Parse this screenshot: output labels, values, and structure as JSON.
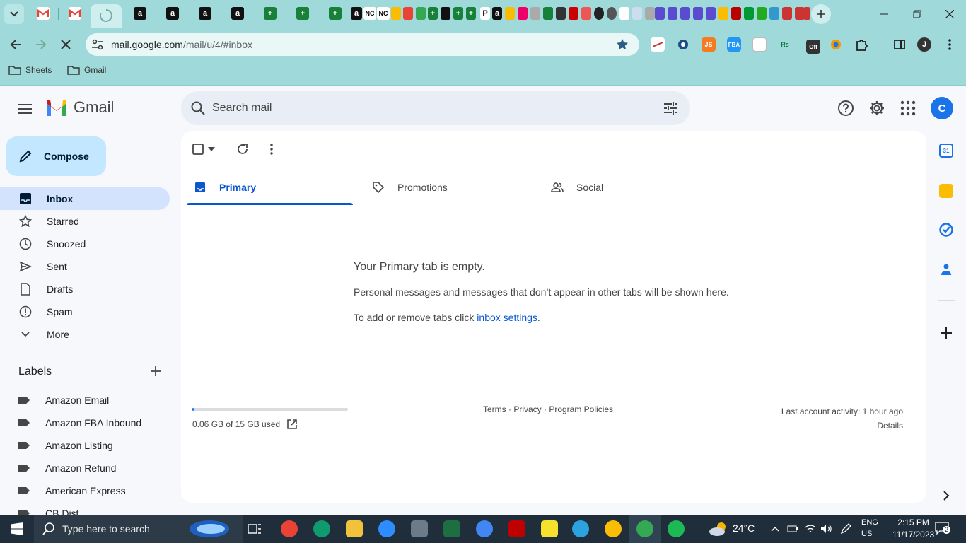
{
  "browser": {
    "url_host": "mail.google.com",
    "url_path": "/mail/u/4/#inbox",
    "tab_glyphs": [
      "a",
      "a",
      "a",
      "a",
      "NC",
      "NC",
      "a",
      "P",
      "a"
    ],
    "bookmarks": [
      "Sheets",
      "Gmail"
    ],
    "extension_labels": [
      "JS",
      "FBA",
      "Rs",
      "Off"
    ],
    "profile_initial": "J"
  },
  "gmail": {
    "logo_text": "Gmail",
    "search_placeholder": "Search mail",
    "avatar_initial": "C",
    "compose_label": "Compose",
    "nav": [
      {
        "label": "Inbox",
        "icon": "inbox-icon"
      },
      {
        "label": "Starred",
        "icon": "star-icon"
      },
      {
        "label": "Snoozed",
        "icon": "clock-icon"
      },
      {
        "label": "Sent",
        "icon": "send-icon"
      },
      {
        "label": "Drafts",
        "icon": "draft-icon"
      },
      {
        "label": "Spam",
        "icon": "spam-icon"
      },
      {
        "label": "More",
        "icon": "chevron-down-icon"
      }
    ],
    "labels_heading": "Labels",
    "labels": [
      "Amazon Email",
      "Amazon FBA Inbound",
      "Amazon Listing",
      "Amazon Refund",
      "American Express",
      "CB Dist"
    ],
    "tabs": [
      {
        "label": "Primary",
        "icon": "inbox-tab-icon"
      },
      {
        "label": "Promotions",
        "icon": "tag-icon"
      },
      {
        "label": "Social",
        "icon": "people-icon"
      }
    ],
    "empty": {
      "title": "Your Primary tab is empty.",
      "description": "Personal messages and messages that don’t appear in other tabs will be shown here.",
      "settings_prefix": "To add or remove tabs click ",
      "settings_link": "inbox settings",
      "settings_suffix": "."
    },
    "storage_text": "0.06 GB of 15 GB used",
    "storage_fraction": 0.004,
    "footer_links": "Terms · Privacy · Program Policies",
    "last_activity": "Last account activity: 1 hour ago",
    "details_link": "Details",
    "calendar_day": "31"
  },
  "taskbar": {
    "search_placeholder": "Type here to search",
    "weather": "24°C",
    "lang": "ENG",
    "region": "US",
    "time": "2:15 PM",
    "date": "11/17/2023",
    "notification_count": "2"
  },
  "colors": {
    "chrome_bg": "#9fd9d9",
    "accent": "#0b57d0",
    "compose_bg": "#c2e7ff",
    "active_nav": "#d3e3fd",
    "taskbar_bg": "#1f2e3a"
  }
}
